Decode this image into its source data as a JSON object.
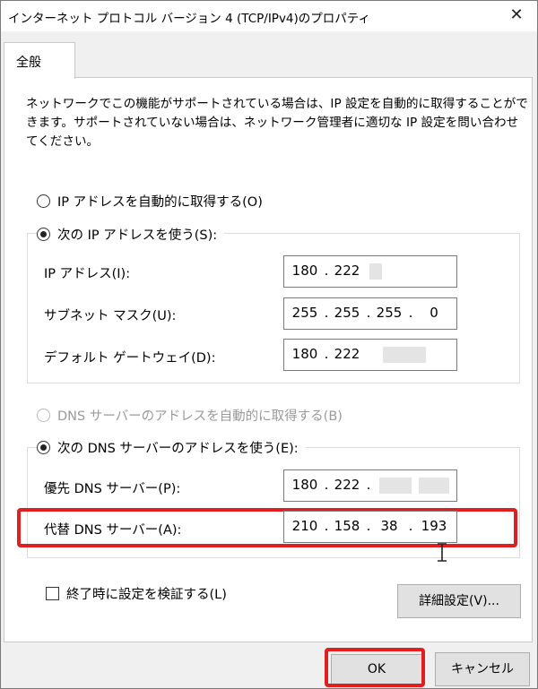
{
  "window": {
    "title": "インターネット プロトコル バージョン 4 (TCP/IPv4)のプロパティ",
    "close_symbol": "✕"
  },
  "tab": {
    "label": "全般"
  },
  "description": "ネットワークでこの機能がサポートされている場合は、IP 設定を自動的に取得することができます。サポートされていない場合は、ネットワーク管理者に適切な IP 設定を問い合わせてください。",
  "ip_section": {
    "auto_radio": {
      "label": "IP アドレスを自動的に取得する(O)",
      "selected": false
    },
    "manual_radio": {
      "label": "次の IP アドレスを使う(S):",
      "selected": true
    },
    "fields": [
      {
        "label": "IP アドレス(I):",
        "octets": [
          "180",
          "222",
          "",
          ""
        ]
      },
      {
        "label": "サブネット マスク(U):",
        "octets": [
          "255",
          "255",
          "255",
          "0"
        ]
      },
      {
        "label": "デフォルト ゲートウェイ(D):",
        "octets": [
          "180",
          "222",
          "",
          ""
        ]
      }
    ]
  },
  "dns_section": {
    "auto_radio": {
      "label": "DNS サーバーのアドレスを自動的に取得する(B)",
      "selected": false,
      "disabled": true
    },
    "manual_radio": {
      "label": "次の DNS サーバーのアドレスを使う(E):",
      "selected": true
    },
    "fields": [
      {
        "label": "優先 DNS サーバー(P):",
        "octets": [
          "180",
          "222",
          "",
          ""
        ]
      },
      {
        "label": "代替 DNS サーバー(A):",
        "octets": [
          "210",
          "158",
          "38",
          "193"
        ]
      }
    ]
  },
  "validate_checkbox": {
    "label": "終了時に設定を検証する(L)",
    "checked": false
  },
  "buttons": {
    "advanced": "詳細設定(V)...",
    "ok": "OK",
    "cancel": "キャンセル"
  },
  "colors": {
    "highlight": "#e02020",
    "panel_background": "#ffffff",
    "dialog_background": "#f0f0f0"
  }
}
